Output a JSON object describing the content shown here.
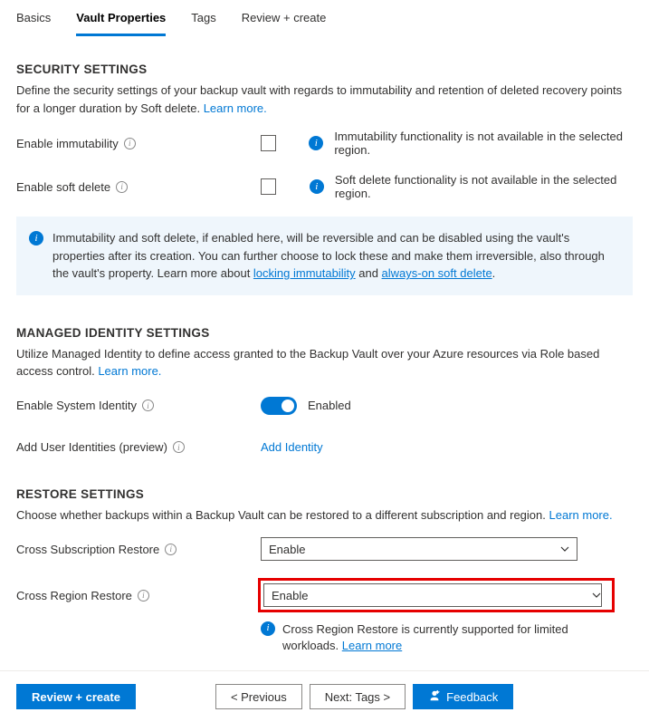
{
  "tabs": {
    "basics": "Basics",
    "vault_properties": "Vault Properties",
    "tags": "Tags",
    "review_create": "Review + create"
  },
  "security": {
    "title": "SECURITY SETTINGS",
    "desc": "Define the security settings of your backup vault with regards to immutability and retention of deleted recovery points for a longer duration by Soft delete. ",
    "learn_more": "Learn more.",
    "immutability_label": "Enable immutability",
    "immutability_msg": "Immutability functionality is not available in the selected region.",
    "soft_delete_label": "Enable soft delete",
    "soft_delete_msg": "Soft delete functionality is not available in the selected region.",
    "banner_pre": "Immutability and soft delete, if enabled here, will be reversible and can be disabled using the vault's properties after its creation. You can further choose to lock these and make them irreversible, also through the vault's property. Learn more about ",
    "banner_link1": "locking immutability",
    "banner_and": " and ",
    "banner_link2": "always-on soft delete",
    "banner_period": "."
  },
  "identity": {
    "title": "MANAGED IDENTITY SETTINGS",
    "desc": "Utilize Managed Identity to define access granted to the Backup Vault over your Azure resources via Role based access control. ",
    "learn_more": "Learn more.",
    "system_identity_label": "Enable System Identity",
    "system_identity_state": "Enabled",
    "add_user_label": "Add User Identities (preview)",
    "add_identity_link": "Add Identity"
  },
  "restore": {
    "title": "RESTORE SETTINGS",
    "desc": "Choose whether backups within a Backup Vault can be restored to a different subscription and region. ",
    "learn_more": "Learn more.",
    "cross_sub_label": "Cross Subscription Restore",
    "cross_sub_value": "Enable",
    "cross_region_label": "Cross Region Restore",
    "cross_region_value": "Enable",
    "cross_region_info_pre": "Cross Region Restore is currently supported for limited workloads. ",
    "cross_region_info_link": "Learn more"
  },
  "footer": {
    "review_create": "Review + create",
    "previous": "< Previous",
    "next": "Next: Tags >",
    "feedback": "Feedback"
  }
}
